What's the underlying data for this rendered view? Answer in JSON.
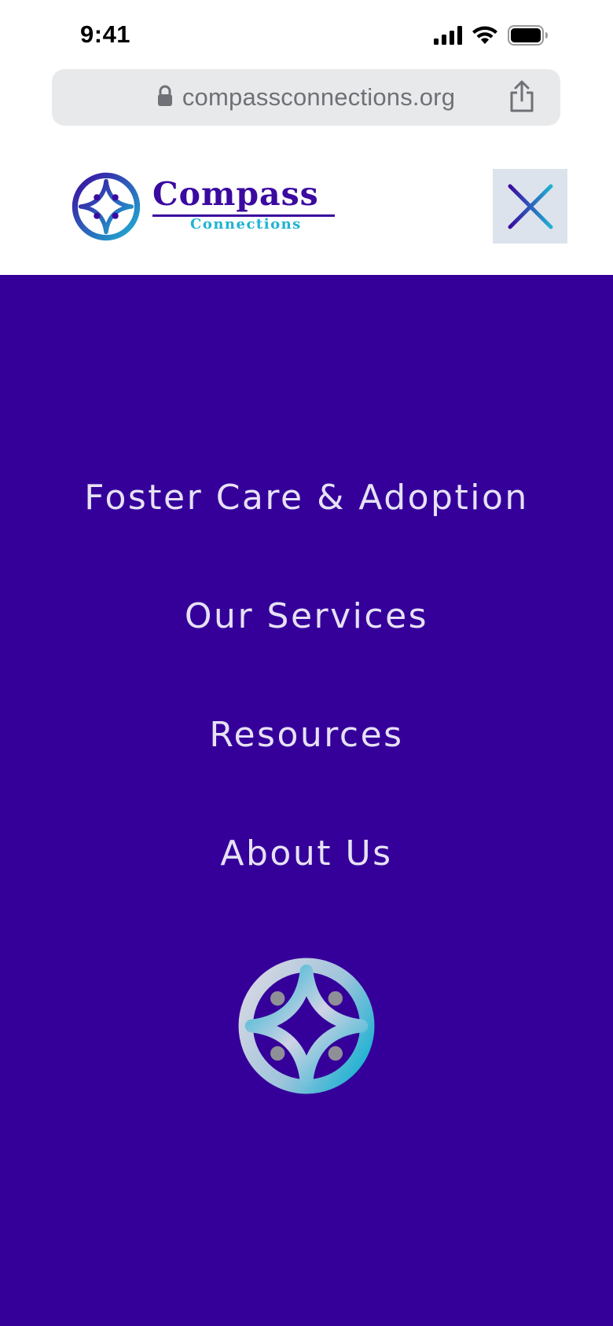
{
  "status_bar": {
    "time": "9:41",
    "icons": [
      "signal-icon",
      "wifi-icon",
      "battery-icon"
    ]
  },
  "browser": {
    "url": "compassconnections.org",
    "icons": [
      "lock-icon",
      "share-icon"
    ]
  },
  "header": {
    "logo_title": "Compass",
    "logo_subtitle": "Connections",
    "close_icon": "close-icon"
  },
  "menu": {
    "items": [
      {
        "label": "Foster Care & Adoption"
      },
      {
        "label": "Our Services"
      },
      {
        "label": "Resources"
      },
      {
        "label": "About Us"
      }
    ],
    "logo_icon": "compass-logo-icon"
  },
  "colors": {
    "menu_background": "#35009a",
    "menu_text": "#e6e1f4",
    "brand_purple": "#3b0aa0",
    "brand_teal": "#1fb3d2",
    "close_button_bg": "#dde3ec",
    "address_bar_bg": "#e8e9eb"
  }
}
